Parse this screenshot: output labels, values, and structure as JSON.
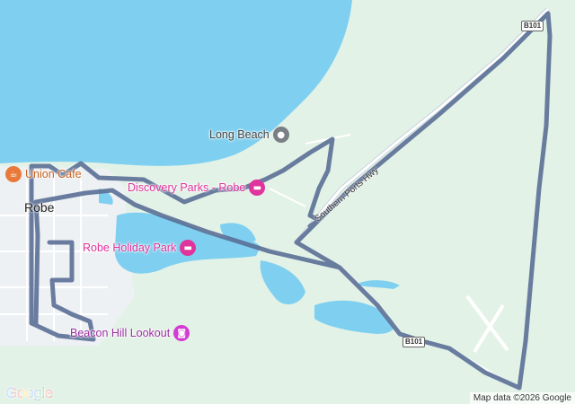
{
  "map": {
    "colors": {
      "water": "#7fd0f0",
      "land": "#e3f2e7",
      "town_area": "#eef1f3",
      "route": "#5a6f96",
      "poi_lodging": "#e0339c",
      "poi_generic": "#7a7f85",
      "poi_food": "#e8793a",
      "poi_view": "#d43bd3"
    },
    "town_label": "Robe",
    "pois": [
      {
        "id": "long-beach",
        "label": "Long Beach",
        "icon": "place-pin-icon",
        "type": "generic"
      },
      {
        "id": "union-cafe",
        "label": "Union Cafe",
        "icon": "coffee-cup-icon",
        "type": "food"
      },
      {
        "id": "discovery-parks",
        "label": "Discovery Parks - Robe",
        "icon": "bed-icon",
        "type": "lodging"
      },
      {
        "id": "robe-holiday-park",
        "label": "Robe Holiday Park",
        "icon": "bed-icon",
        "type": "lodging"
      },
      {
        "id": "beacon-hill-lookout",
        "label": "Beacon Hill Lookout",
        "icon": "camera-icon",
        "type": "view"
      }
    ],
    "road_shields": [
      "B101",
      "B101"
    ],
    "road_name": "Southern Ports Hwy",
    "logo": "Google",
    "attribution": "Map data ©2026 Google"
  }
}
